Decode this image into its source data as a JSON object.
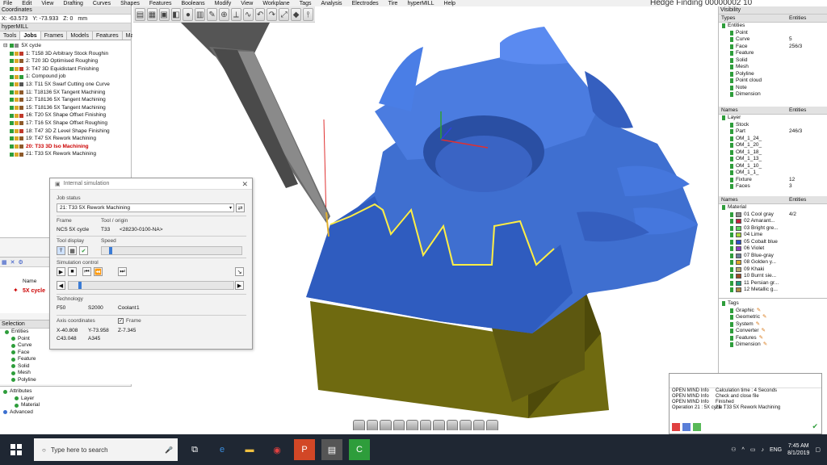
{
  "menu": [
    "File",
    "Edit",
    "View",
    "Drafting",
    "Curves",
    "Shapes",
    "Features",
    "Booleans",
    "Modify",
    "View",
    "Workplane",
    "Tags",
    "Analysis",
    "Electrodes",
    "Tire",
    "hyperMILL",
    "Help"
  ],
  "window_title_fragment": "Hedge Finding 00000002 10",
  "coordinates_panel": {
    "title": "Coordinates",
    "x_label": "X:",
    "x": "-63.573",
    "y_label": "Y:",
    "y": "-73.933",
    "z_label": "Z:",
    "z": "0",
    "unit": "mm"
  },
  "hypermill_panel": {
    "title": "hyperMILL",
    "tabs": [
      "Tools",
      "Jobs",
      "Frames",
      "Models",
      "Features",
      "Macros"
    ],
    "active_tab": "Jobs",
    "root": "5X cycle",
    "jobs": [
      "1: T158 3D Arbitrary Stock Roughin",
      "2: T20 3D Optimised Roughing",
      "3: T47 3D Equidistant Finishing",
      "1: Compound job",
      "13: T11 5X Swarf Cutting one Curve",
      "11: T18136 5X Tangent Machining",
      "12: T18136 5X Tangent Machining",
      "15: T18136 5X Tangent Machining",
      "16: T20 5X Shape Offset Finishing",
      "17: T16 5X Shape Offset Roughing",
      "18: T47 3D Z Level Shape Finishing",
      "19: T47 5X Rework Machining",
      "20: T33 3D Iso Machining",
      "21: T33 5X Rework Machining"
    ],
    "highlighted_job": "20: T33 3D Iso Machining"
  },
  "lower_panel": {
    "name_header": "Name",
    "job_name": "5X cycle"
  },
  "selection_panel": {
    "title": "Selection",
    "items": [
      "Entities",
      "Point",
      "Curve",
      "Face",
      "Feature",
      "Solid",
      "Mesh",
      "Polyline"
    ]
  },
  "attributes_panel": {
    "items": [
      "Attributes",
      "Layer",
      "Material",
      "Advanced"
    ]
  },
  "simulation_dialog": {
    "title": "Internal simulation",
    "job_status_label": "Job status",
    "job_status_value": "21: T33 5X Rework Machining",
    "frame_label": "Frame",
    "frame_value": "NCS 5X cycle",
    "tool_origin_label": "Tool / origin",
    "tool_value": "T33",
    "origin_value": "<28230-0100-NA>",
    "tool_display_label": "Tool display",
    "speed_label": "Speed",
    "speed_fraction": 0.05,
    "simulation_control_label": "Simulation control",
    "progress_fraction": 0.06,
    "technology_label": "Technology",
    "f_value": "F50",
    "s_value": "S2000",
    "coolant_label": "Coolant",
    "coolant_value": "1",
    "axis_coordinates_label": "Axis coordinates",
    "frame_checkbox_label": "Frame",
    "frame_checked": true,
    "x": "X-40.808",
    "y": "Y-73.958",
    "z": "Z-7.345",
    "c": "C43.048",
    "a": "A345"
  },
  "visibility_panel": {
    "title": "Visibility",
    "types_header": "Types",
    "entities_header": "Entities",
    "types": [
      {
        "name": "Entities",
        "count": ""
      },
      {
        "name": "Point",
        "count": ""
      },
      {
        "name": "Curve",
        "count": "5"
      },
      {
        "name": "Face",
        "count": "256/3"
      },
      {
        "name": "Feature",
        "count": ""
      },
      {
        "name": "Solid",
        "count": ""
      },
      {
        "name": "Mesh",
        "count": ""
      },
      {
        "name": "Polyline",
        "count": ""
      },
      {
        "name": "Point cloud",
        "count": ""
      },
      {
        "name": "Note",
        "count": ""
      },
      {
        "name": "Dimension",
        "count": ""
      }
    ]
  },
  "layer_panel": {
    "names_header": "Names",
    "entities_header": "Entities",
    "layers": [
      {
        "name": "Layer",
        "count": ""
      },
      {
        "name": "Stock",
        "count": ""
      },
      {
        "name": "Part",
        "count": "246/3"
      },
      {
        "name": "OM_1_24_",
        "count": ""
      },
      {
        "name": "OM_1_20_",
        "count": ""
      },
      {
        "name": "OM_1_18_",
        "count": ""
      },
      {
        "name": "OM_1_13_",
        "count": ""
      },
      {
        "name": "OM_1_10_",
        "count": ""
      },
      {
        "name": "OM_1_1_",
        "count": ""
      },
      {
        "name": "Fixture",
        "count": "12"
      },
      {
        "name": "Faces",
        "count": "3"
      }
    ]
  },
  "material_panel": {
    "names_header": "Names",
    "entities_header": "Entities",
    "materials": [
      {
        "name": "Material",
        "count": "",
        "color": ""
      },
      {
        "name": "01 Cool gray",
        "count": "4/2",
        "color": "#8d8d8d"
      },
      {
        "name": "02 Amarant...",
        "count": "",
        "color": "#c2243a"
      },
      {
        "name": "03 Bright gre...",
        "count": "",
        "color": "#5fd35f"
      },
      {
        "name": "04 Lime",
        "count": "",
        "color": "#a7d83a"
      },
      {
        "name": "05 Cobalt blue",
        "count": "",
        "color": "#2b4fc4"
      },
      {
        "name": "06 Violet",
        "count": "",
        "color": "#8b3fc0"
      },
      {
        "name": "07 Blue-gray",
        "count": "",
        "color": "#6b7f9a"
      },
      {
        "name": "08 Golden y...",
        "count": "",
        "color": "#d9a826"
      },
      {
        "name": "09 Khaki",
        "count": "",
        "color": "#b7a76e"
      },
      {
        "name": "10 Burnt sie...",
        "count": "",
        "color": "#9a4a25"
      },
      {
        "name": "11 Persian gr...",
        "count": "",
        "color": "#1f9a7c"
      },
      {
        "name": "12 Metallic g...",
        "count": "",
        "color": "#b08a3d"
      }
    ]
  },
  "tags_panel": {
    "items": [
      "Tags",
      "Graphic",
      "Geometric",
      "System",
      "Converter",
      "Features",
      "Dimension"
    ]
  },
  "log": [
    {
      "src": "OPEN MIND Info",
      "msg": "Calculation time : 4 Seconds"
    },
    {
      "src": "OPEN MIND Info",
      "msg": "Check and close file"
    },
    {
      "src": "OPEN MIND Info",
      "msg": "Finished"
    },
    {
      "src": "Operation 21 : 5X cycle :",
      "msg": "21: T33 5X Rework Machining"
    }
  ],
  "taskbar": {
    "search_placeholder": "Type here to search",
    "lang": "ENG",
    "time": "7:45 AM",
    "date": "8/1/2019"
  },
  "colors": {
    "part_blue": "#3f6fd0",
    "part_blue_dark": "#2a4fa3",
    "stock_olive": "#6f6a10",
    "stock_olive_dark": "#4e4a0a",
    "toolpath_yellow": "#ffee44",
    "taskbar": "#1f2733"
  }
}
